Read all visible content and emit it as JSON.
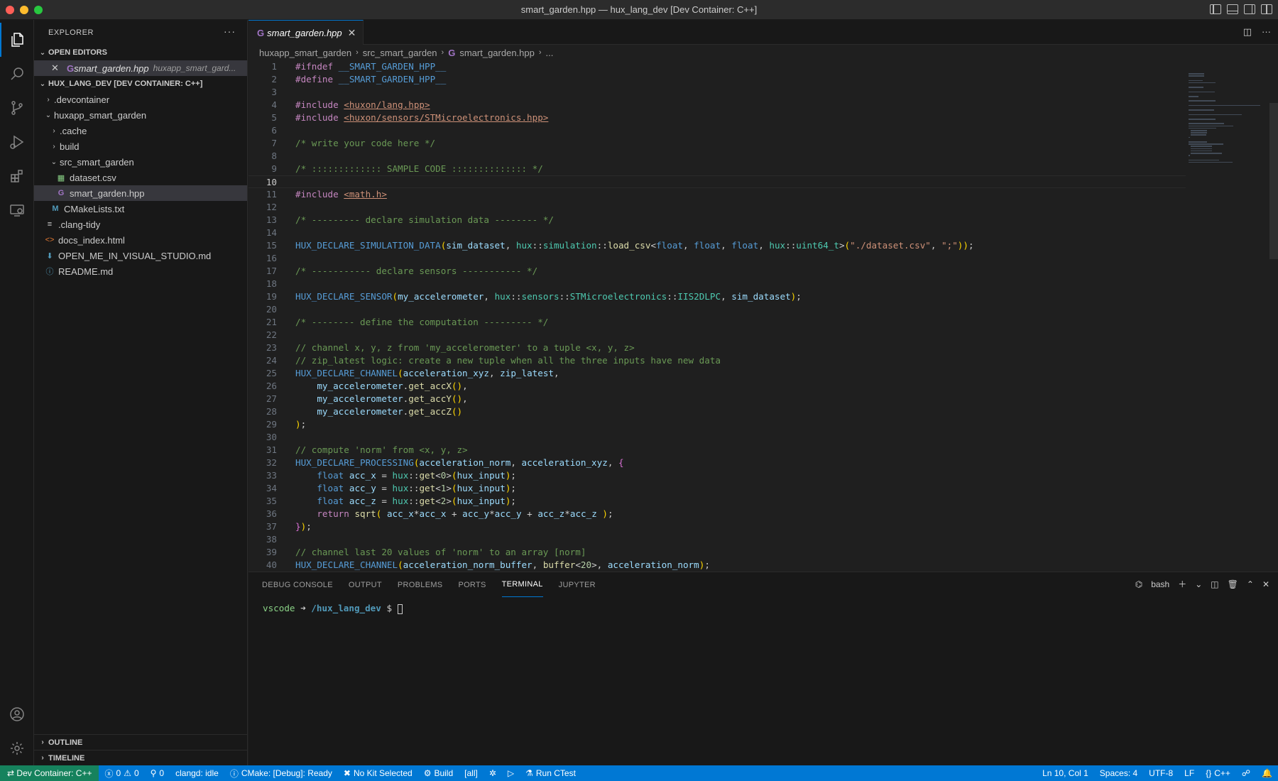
{
  "window": {
    "title": "smart_garden.hpp — hux_lang_dev [Dev Container: C++]"
  },
  "activity_bar": {
    "items": [
      "explorer-icon",
      "search-icon",
      "source-control-icon",
      "run-debug-icon",
      "extensions-icon",
      "remote-explorer-icon"
    ],
    "bottom": [
      "accounts-icon",
      "settings-gear-icon"
    ]
  },
  "sidebar": {
    "header": "EXPLORER",
    "more": "···",
    "open_editors": {
      "title": "OPEN EDITORS",
      "items": [
        {
          "name": "smart_garden.hpp",
          "description": "huxapp_smart_gard..."
        }
      ]
    },
    "workspace": {
      "title": "HUX_LANG_DEV [DEV CONTAINER: C++]",
      "items": [
        {
          "label": ".devcontainer",
          "type": "folder",
          "expanded": false
        },
        {
          "label": "huxapp_smart_garden",
          "type": "folder",
          "expanded": true
        },
        {
          "label": ".cache",
          "type": "folder",
          "expanded": false
        },
        {
          "label": "build",
          "type": "folder",
          "expanded": false
        },
        {
          "label": "src_smart_garden",
          "type": "folder",
          "expanded": true
        },
        {
          "label": "dataset.csv",
          "type": "csv"
        },
        {
          "label": "smart_garden.hpp",
          "type": "cpp",
          "selected": true
        },
        {
          "label": "CMakeLists.txt",
          "type": "cmake"
        },
        {
          "label": ".clang-tidy",
          "type": "lines"
        },
        {
          "label": "docs_index.html",
          "type": "html"
        },
        {
          "label": "OPEN_ME_IN_VISUAL_STUDIO.md",
          "type": "md"
        },
        {
          "label": "README.md",
          "type": "info"
        }
      ]
    },
    "outline": "OUTLINE",
    "timeline": "TIMELINE"
  },
  "editor": {
    "tab": {
      "name": "smart_garden.hpp",
      "close": "✕"
    },
    "breadcrumbs": [
      "huxapp_smart_garden",
      "src_smart_garden",
      "smart_garden.hpp",
      "..."
    ],
    "current_line": 10,
    "lines": [
      "#ifndef __SMART_GARDEN_HPP__",
      "#define __SMART_GARDEN_HPP__",
      "",
      "#include <huxon/lang.hpp>",
      "#include <huxon/sensors/STMicroelectronics.hpp>",
      "",
      "/* write your code here */",
      "",
      "/* ::::::::::::: SAMPLE CODE :::::::::::::: */",
      "",
      "#include <math.h>",
      "",
      "/* --------- declare simulation data -------- */",
      "",
      "HUX_DECLARE_SIMULATION_DATA(sim_dataset, hux::simulation::load_csv<float, float, float, hux::uint64_t>(\"./dataset.csv\", \";\"));",
      "",
      "/* ----------- declare sensors ----------- */",
      "",
      "HUX_DECLARE_SENSOR(my_accelerometer, hux::sensors::STMicroelectronics::IIS2DLPC, sim_dataset);",
      "",
      "/* -------- define the computation --------- */",
      "",
      "// channel x, y, z from 'my_accelerometer' to a tuple <x, y, z>",
      "// zip_latest logic: create a new tuple when all the three inputs have new data",
      "HUX_DECLARE_CHANNEL(acceleration_xyz, zip_latest,",
      "    my_accelerometer.get_accX(),",
      "    my_accelerometer.get_accY(),",
      "    my_accelerometer.get_accZ()",
      ");",
      "",
      "// compute 'norm' from <x, y, z>",
      "HUX_DECLARE_PROCESSING(acceleration_norm, acceleration_xyz, {",
      "    float acc_x = hux::get<0>(hux_input);",
      "    float acc_y = hux::get<1>(hux_input);",
      "    float acc_z = hux::get<2>(hux_input);",
      "    return sqrt( acc_x*acc_x + acc_y*acc_y + acc_z*acc_z );",
      "});",
      "",
      "// channel last 20 values of 'norm' to an array [norm]",
      "HUX_DECLARE_CHANNEL(acceleration_norm_buffer, buffer<20>, acceleration_norm);"
    ]
  },
  "panel": {
    "tabs": [
      "DEBUG CONSOLE",
      "OUTPUT",
      "PROBLEMS",
      "PORTS",
      "TERMINAL",
      "JUPYTER"
    ],
    "active_tab": "TERMINAL",
    "shell": "bash",
    "terminal": {
      "user": "vscode",
      "arrow": "➜",
      "path": "/hux_lang_dev",
      "prompt": "$"
    }
  },
  "statusbar": {
    "remote": "Dev Container: C++",
    "errors": "0",
    "warnings": "0",
    "ports": "0",
    "clangd": "clangd: idle",
    "cmake": "CMake: [Debug]: Ready",
    "kit": "No Kit Selected",
    "build": "Build",
    "target": "[all]",
    "ctest": "Run CTest",
    "position": "Ln 10, Col 1",
    "spaces": "Spaces: 4",
    "encoding": "UTF-8",
    "eol": "LF",
    "language": "C++"
  },
  "colors": {
    "statusbar": "#0078d4",
    "remote": "#16825d",
    "accent": "#0078d4"
  }
}
